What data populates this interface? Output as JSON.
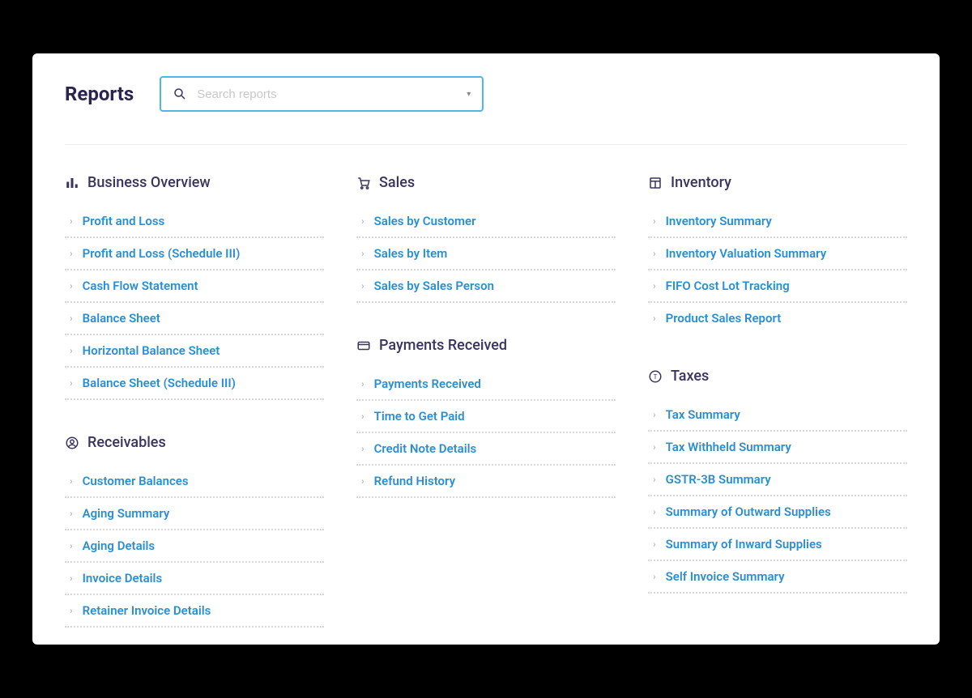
{
  "header": {
    "title": "Reports",
    "search_placeholder": "Search reports"
  },
  "columns": [
    {
      "sections": [
        {
          "icon": "bar-chart-icon",
          "title": "Business Overview",
          "items": [
            "Profit and Loss",
            "Profit and Loss (Schedule III)",
            "Cash Flow Statement",
            "Balance Sheet",
            "Horizontal Balance Sheet",
            "Balance Sheet (Schedule III)"
          ]
        },
        {
          "icon": "person-circle-icon",
          "title": "Receivables",
          "items": [
            "Customer Balances",
            "Aging Summary",
            "Aging Details",
            "Invoice Details",
            "Retainer Invoice Details"
          ]
        }
      ]
    },
    {
      "sections": [
        {
          "icon": "cart-icon",
          "title": "Sales",
          "items": [
            "Sales by Customer",
            "Sales by Item",
            "Sales by Sales Person"
          ]
        },
        {
          "icon": "credit-card-icon",
          "title": "Payments Received",
          "items": [
            "Payments Received",
            "Time to Get Paid",
            "Credit Note Details",
            "Refund History"
          ]
        }
      ]
    },
    {
      "sections": [
        {
          "icon": "box-icon",
          "title": "Inventory",
          "items": [
            "Inventory Summary",
            "Inventory Valuation Summary",
            "FIFO Cost Lot Tracking",
            "Product Sales Report"
          ]
        },
        {
          "icon": "tax-icon",
          "title": "Taxes",
          "items": [
            "Tax Summary",
            "Tax Withheld Summary",
            "GSTR-3B Summary",
            "Summary of Outward Supplies",
            "Summary of Inward Supplies",
            "Self Invoice Summary"
          ]
        }
      ]
    }
  ]
}
